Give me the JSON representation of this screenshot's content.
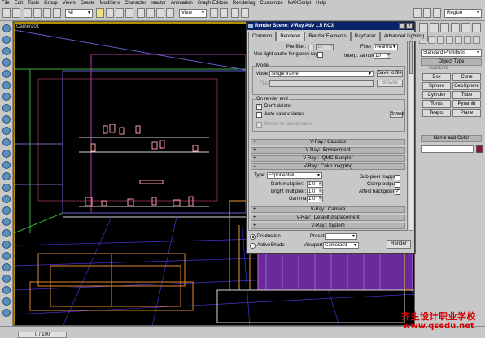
{
  "menu": [
    "File",
    "Edit",
    "Tools",
    "Group",
    "Views",
    "Create",
    "Modifiers",
    "Character",
    "reactor",
    "Animation",
    "Graph Editors",
    "Rendering",
    "Customize",
    "MAXScript",
    "Help"
  ],
  "toolbar": {
    "selection_filter": "All",
    "ref_coord": "View",
    "named_selection": "Region"
  },
  "viewport": {
    "label": "Camera01"
  },
  "command_panel": {
    "category": "Standard Primitives",
    "object_type_title": "Object Type",
    "autogrid": "AutoGrid",
    "primitives": [
      "Box",
      "Cone",
      "Sphere",
      "GeoSphere",
      "Cylinder",
      "Tube",
      "Torus",
      "Pyramid",
      "Teapot",
      "Plane"
    ],
    "name_color_title": "Name and Color",
    "swatch_color": "#9b1030"
  },
  "status": {
    "time": "0 / 100"
  },
  "watermark": {
    "cn": "齐生设计职业学校",
    "url": "www.qsedu.net"
  },
  "dialog": {
    "title": "Render Scene: V-Ray Adv 1.5 RC3",
    "tabs": [
      "Common",
      "Renderer",
      "Render Elements",
      "Raytracer",
      "Advanced Lighting"
    ],
    "prefilter_label": "Pre-filter:",
    "prefilter_value": "10",
    "filter_label": "Filter",
    "filter_value": "Nearest",
    "use_light_cache": "Use light cache for glossy rays",
    "interp_label": "Interp. samples:",
    "interp_value": "10",
    "mode_group": "Mode",
    "mode_label": "Mode:",
    "mode_value": "Single frame",
    "save_to_file": "Save to file",
    "file_label": "File:",
    "browse": "Browse",
    "on_render_end": "On render end",
    "dont_delete": "Don't delete",
    "auto_save": "Auto save:",
    "auto_save_value": "<None>",
    "browse2": "Browse",
    "switch_saved": "Switch to saved cache",
    "rollouts": [
      "V-Ray:: Caustics",
      "V-Ray:: Environment",
      "V-Ray:: rQMC Sampler",
      "V-Ray:: Color mapping"
    ],
    "type_label": "Type:",
    "type_value": "Exponential",
    "dark_mult_label": "Dark multiplier:",
    "dark_mult": "1.0",
    "bright_mult_label": "Bright multiplier:",
    "bright_mult": "1.0",
    "gamma_label": "Gamma",
    "gamma": "1.0",
    "subpixel": "Sub-pixel mapping",
    "clamp": "Clamp output",
    "affect_bg": "Affect background",
    "rollouts_bottom": [
      "V-Ray:: Camera",
      "V-Ray:: Default displacement",
      "V-Ray:: System"
    ],
    "production": "Production",
    "activeshade": "ActiveShade",
    "preset_label": "Preset:",
    "preset_value": "----------",
    "viewport_label": "Viewport:",
    "viewport_value": "Camera01",
    "render": "Render"
  }
}
